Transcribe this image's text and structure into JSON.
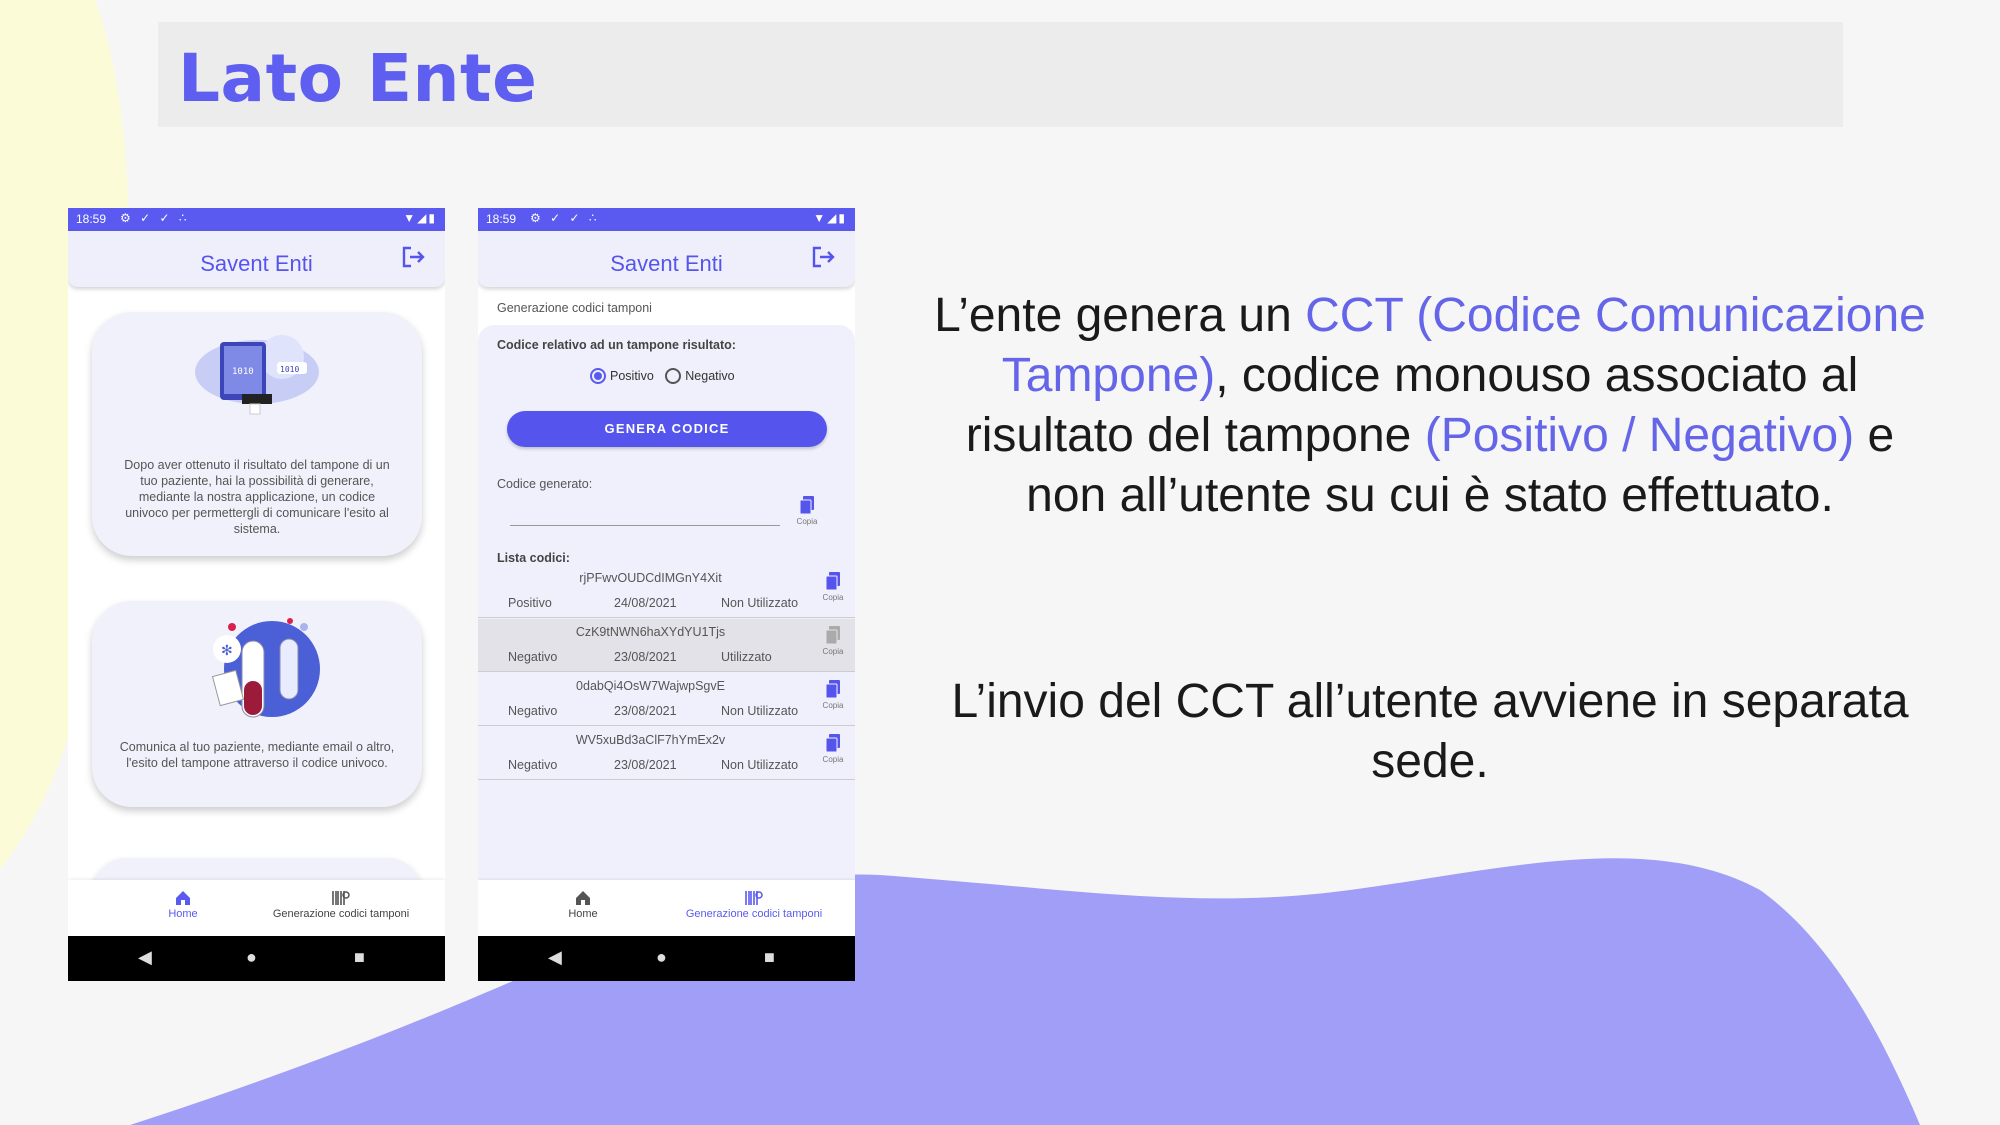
{
  "slide": {
    "title": "Lato Ente",
    "accent_color": "#5e5ef0",
    "text1": {
      "p1": "L’ente genera un ",
      "h1": "CCT (Codice Comunicazione Tampone)",
      "p2": ", codice monouso associato al risultato del tampone ",
      "h2": "(Positivo / Negativo)",
      "p3": " e non all’utente su cui è stato effettuato."
    },
    "text2": "L’invio del CCT all’utente avviene in separata sede."
  },
  "phone1": {
    "status_time": "18:59",
    "app_title": "Savent Enti",
    "card1_text": "Dopo aver ottenuto il risultato del tampone di un tuo paziente, hai la possibilità di generare, mediante la nostra applicazione, un codice univoco per permettergli di comunicare l'esito al sistema.",
    "card2_text": "Comunica al tuo paziente, mediante email o altro, l'esito del tampone attraverso il codice univoco.",
    "nav": {
      "home": "Home",
      "gen": "Generazione codici tamponi"
    }
  },
  "phone2": {
    "status_time": "18:59",
    "app_title": "Savent Enti",
    "section_label": "Generazione codici tamponi",
    "form_label": "Codice relativo ad un tampone risultato:",
    "radio_pos": "Positivo",
    "radio_neg": "Negativo",
    "button": "GENERA CODICE",
    "generated_label": "Codice generato:",
    "copy_label": "Copia",
    "list_label": "Lista codici:",
    "rows": [
      {
        "code": "rjPFwvOUDCdIMGnY4Xit",
        "type": "Positivo",
        "date": "24/08/2021",
        "status": "Non Utilizzato"
      },
      {
        "code": "CzK9tNWN6haXYdYU1Tjs",
        "type": "Negativo",
        "date": "23/08/2021",
        "status": "Utilizzato"
      },
      {
        "code": "0dabQi4OsW7WajwpSgvE",
        "type": "Negativo",
        "date": "23/08/2021",
        "status": "Non Utilizzato"
      },
      {
        "code": "WV5xuBd3aClF7hYmEx2v",
        "type": "Negativo",
        "date": "23/08/2021",
        "status": "Non Utilizzato"
      }
    ],
    "nav": {
      "home": "Home",
      "gen": "Generazione codici tamponi"
    }
  }
}
